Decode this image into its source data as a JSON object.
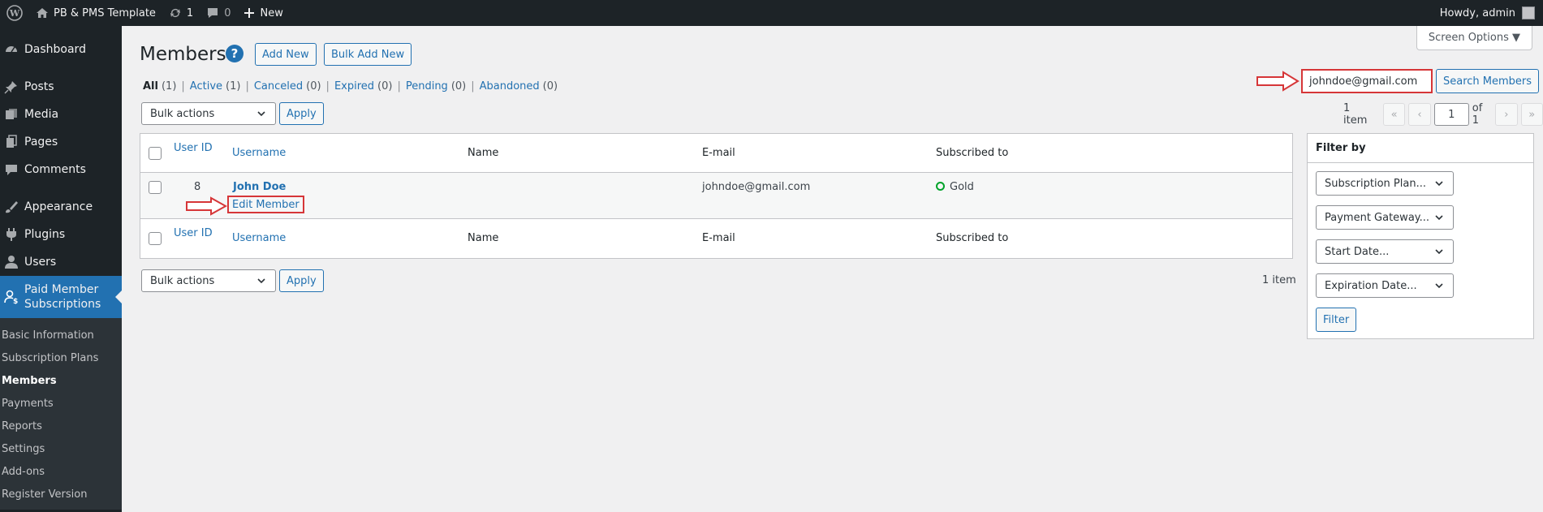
{
  "adminbar": {
    "site_name": "PB & PMS Template",
    "updates_count": "1",
    "comments_count": "0",
    "new_label": "New",
    "greeting": "Howdy, admin"
  },
  "sidebar": {
    "items": [
      {
        "label": "Dashboard",
        "icon": "dashboard-icon"
      },
      {
        "label": "Posts",
        "icon": "pin-icon"
      },
      {
        "label": "Media",
        "icon": "media-icon"
      },
      {
        "label": "Pages",
        "icon": "pages-icon"
      },
      {
        "label": "Comments",
        "icon": "comment-icon"
      },
      {
        "label": "Appearance",
        "icon": "brush-icon"
      },
      {
        "label": "Plugins",
        "icon": "plugin-icon"
      },
      {
        "label": "Users",
        "icon": "user-icon"
      },
      {
        "label": "Paid Member Subscriptions",
        "icon": "members-icon"
      }
    ],
    "submenu": [
      "Basic Information",
      "Subscription Plans",
      "Members",
      "Payments",
      "Reports",
      "Settings",
      "Add-ons",
      "Register Version"
    ]
  },
  "header": {
    "title": "Members",
    "help": "?",
    "add_new": "Add New",
    "bulk_add_new": "Bulk Add New",
    "screen_options": "Screen Options ▼"
  },
  "views": [
    {
      "label": "All",
      "count": "(1)"
    },
    {
      "label": "Active",
      "count": "(1)"
    },
    {
      "label": "Canceled",
      "count": "(0)"
    },
    {
      "label": "Expired",
      "count": "(0)"
    },
    {
      "label": "Pending",
      "count": "(0)"
    },
    {
      "label": "Abandoned",
      "count": "(0)"
    }
  ],
  "search": {
    "value": "johndoe@gmail.com",
    "button": "Search Members"
  },
  "bulk": {
    "select_label": "Bulk actions",
    "apply": "Apply"
  },
  "pagination": {
    "items": "1 item",
    "first": "«",
    "prev": "‹",
    "current": "1",
    "of": "of 1",
    "next": "›",
    "last": "»"
  },
  "table": {
    "columns": {
      "user_id": "User ID",
      "username": "Username",
      "name": "Name",
      "email": "E-mail",
      "subscribed": "Subscribed to"
    },
    "rows": [
      {
        "user_id": "8",
        "username": "John Doe",
        "row_action": "Edit Member",
        "name": "",
        "email": "johndoe@gmail.com",
        "subscription": "Gold"
      }
    ]
  },
  "filter": {
    "title": "Filter by",
    "selects": [
      "Subscription Plan...",
      "Payment Gateway...",
      "Start Date...",
      "Expiration Date..."
    ],
    "button": "Filter"
  },
  "colors": {
    "accent": "#2271b1",
    "annotation_red": "#d63638",
    "status_green": "#00a32a"
  }
}
